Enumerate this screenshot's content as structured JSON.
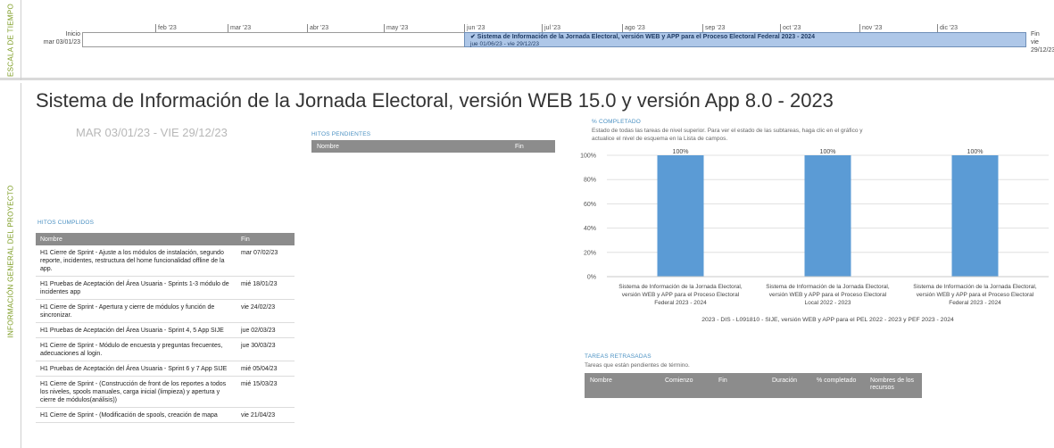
{
  "timeline": {
    "side_label": "ESCALA DE TIEMPO",
    "start_label": "Inicio",
    "start_date": "mar 03/01/23",
    "end_label": "Fin",
    "end_date": "vie 29/12/23",
    "months": [
      "feb '23",
      "mar '23",
      "abr '23",
      "may '23",
      "jun '23",
      "jul '23",
      "ago '23",
      "sep '23",
      "oct '23",
      "nov '23",
      "dic '23"
    ],
    "task": {
      "name": "✔ Sistema de Información de la Jornada Electoral, versión WEB y APP para el Proceso Electoral Federal 2023 - 2024",
      "dates": "jue 01/06/23 - vie 29/12/23"
    }
  },
  "overview": {
    "side_label": "INFORMACIÓN GENERAL DEL PROYECTO",
    "title": "Sistema de Información de la Jornada Electoral, versión WEB 15.0 y versión App 8.0 - 2023",
    "date_range": "MAR 03/01/23 - VIE 29/12/23"
  },
  "pending": {
    "title": "HITOS PENDIENTES",
    "headers": [
      "Nombre",
      "Fin"
    ]
  },
  "completed": {
    "title": "HITOS CUMPLIDOS",
    "headers": [
      "Nombre",
      "Fin"
    ],
    "rows": [
      {
        "name": "H1 Cierre de Sprint -  Ajuste a los módulos de instalación, segundo reporte, incidentes, restructura del home funcionalidad offline de la app.",
        "end": "mar 07/02/23"
      },
      {
        "name": "H1 Pruebas de Aceptación del Área Usuaria - Sprints 1-3 módulo de incidentes app",
        "end": "mié 18/01/23"
      },
      {
        "name": "H1 Cierre de Sprint -  Apertura y cierre de módulos y función de sincronizar.",
        "end": "vie 24/02/23"
      },
      {
        "name": "H1 Pruebas de Aceptación del Área Usuaria - Sprint 4, 5 App SIJE",
        "end": "jue 02/03/23"
      },
      {
        "name": "H1 Cierre de Sprint -  Módulo de encuesta y preguntas frecuentes, adecuaciones al login.",
        "end": "jue 30/03/23"
      },
      {
        "name": "H1 Pruebas de Aceptación del Área Usuaria - Sprint  6 y 7 App SIJE",
        "end": "mié 05/04/23"
      },
      {
        "name": "H1 Cierre de Sprint -  (Construcción de front de los reportes a todos los niveles, spools manuales, carga inicial (limpieza) y apertura y cierre de módulos(análisis))",
        "end": "mié 15/03/23"
      },
      {
        "name": "H1 Cierre de Sprint - (Modificación de spools, creación de mapa",
        "end": "vie 21/04/23"
      }
    ]
  },
  "chart": {
    "title": "% COMPLETADO",
    "description": "Estado de todas las tareas de nivel superior. Para ver el estado de las subtareas, haga clic en el gráfico y actualice el nivel de esquema en la Lista de campos.",
    "bar_color": "#5b9bd5"
  },
  "chart_data": {
    "type": "bar",
    "categories": [
      [
        "Sistema de Información de la Jornada Electoral,",
        "versión WEB y APP para el Proceso Electoral",
        "Federal 2023 - 2024"
      ],
      [
        "Sistema de Información de la Jornada Electoral,",
        "versión WEB y APP para el Proceso Electoral",
        "Local 2022 - 2023"
      ],
      [
        "Sistema de Información de la Jornada Electoral,",
        "versión WEB y APP para el Proceso Electoral",
        "Federal 2023 - 2024"
      ]
    ],
    "values": [
      100,
      100,
      100
    ],
    "data_labels": [
      "100%",
      "100%",
      "100%"
    ],
    "y_ticks": [
      "0%",
      "20%",
      "40%",
      "60%",
      "80%",
      "100%"
    ],
    "ylim": [
      0,
      100
    ],
    "grid": true,
    "xlabel": "2023 - DIS - L091810 - SIJE, versión WEB y APP para el PEL 2022 - 2023 y PEF 2023 - 2024"
  },
  "delayed": {
    "title": "TAREAS RETRASADAS",
    "description": "Tareas que están pendientes de término.",
    "headers": [
      "Nombre",
      "Comienzo",
      "Fin",
      "Duración",
      "% completado",
      "Nombres de los recursos"
    ]
  }
}
